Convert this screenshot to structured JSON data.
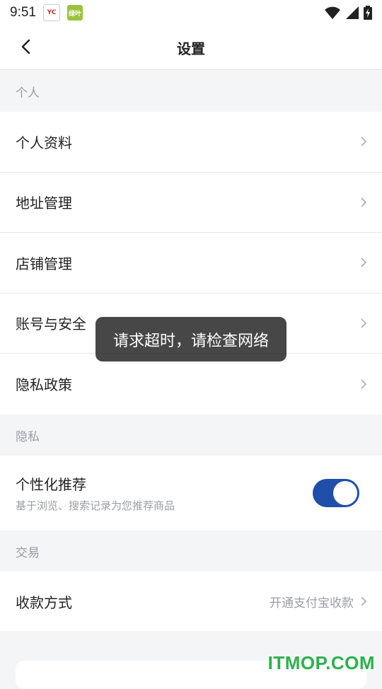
{
  "status_bar": {
    "time": "9:51",
    "app_badges": [
      "YC",
      "绿叶"
    ],
    "icons": [
      "wifi-icon",
      "signal-icon",
      "battery-charging-icon"
    ]
  },
  "header": {
    "title": "设置",
    "back_icon": "chevron-left-icon"
  },
  "sections": {
    "personal": {
      "title": "个人",
      "items": [
        {
          "label": "个人资料"
        },
        {
          "label": "地址管理"
        },
        {
          "label": "店铺管理"
        },
        {
          "label": "账号与安全"
        },
        {
          "label": "隐私政策"
        }
      ]
    },
    "privacy": {
      "title": "隐私",
      "toggle": {
        "title": "个性化推荐",
        "description": "基于浏览、搜索记录为您推荐商品",
        "on": true
      }
    },
    "trade": {
      "title": "交易",
      "items": [
        {
          "label": "收款方式",
          "value": "开通支付宝收款"
        }
      ]
    }
  },
  "toast": {
    "message": "请求超时，请检查网络"
  },
  "watermark": {
    "text": "ITMOP.COM"
  },
  "colors": {
    "accent": "#1f4fa8",
    "background": "#f4f5f7",
    "watermark": "#2bb24c"
  }
}
